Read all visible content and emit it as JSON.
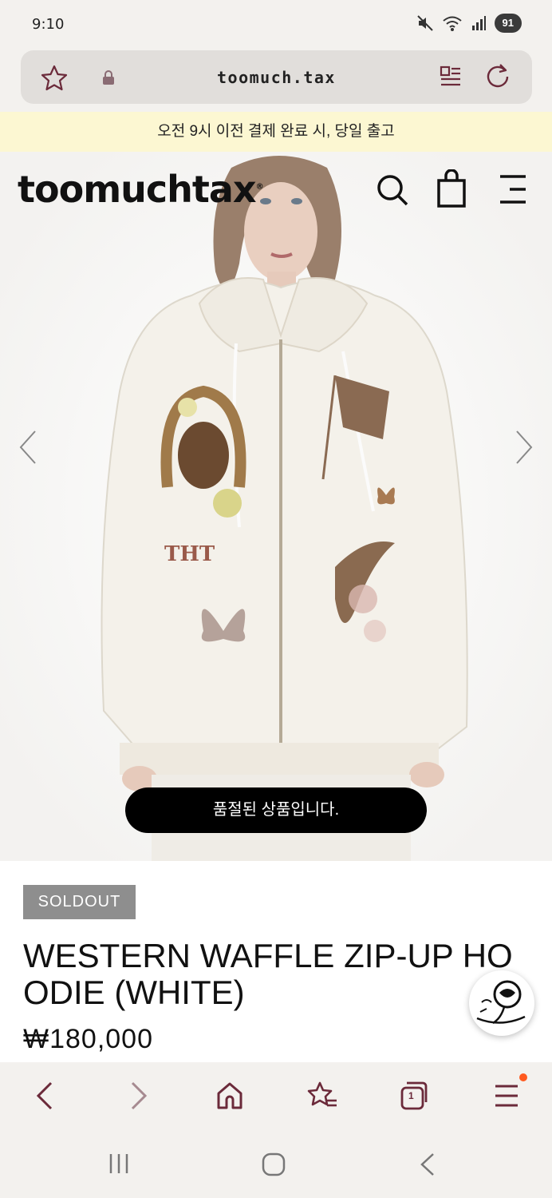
{
  "status": {
    "time": "9:10",
    "battery": "91",
    "icons": [
      "mute-icon",
      "wifi-icon",
      "signal-icon",
      "battery-icon"
    ]
  },
  "browser": {
    "url": "toomuch.tax",
    "icons": [
      "star-icon",
      "lock-icon",
      "reader-icon",
      "reload-icon"
    ]
  },
  "notice": {
    "text": "오전 9시 이전 결제 완료 시, 당일 출고"
  },
  "header": {
    "logo": "toomuchtax",
    "logo_mark": "®",
    "icons": [
      "search-icon",
      "bag-icon",
      "menu-icon"
    ]
  },
  "gallery": {
    "toast": "품절된 상품입니다.",
    "prev_icon": "chevron-left-icon",
    "next_icon": "chevron-right-icon"
  },
  "product": {
    "badge": "SOLDOUT",
    "name": "WESTERN WAFFLE ZIP-UP HOODIE (WHITE)",
    "price": "₩180,000"
  },
  "toolbar": {
    "items": [
      "back-icon",
      "forward-icon",
      "home-icon",
      "bookmarks-icon",
      "tabs-icon",
      "menu-icon"
    ],
    "tab_count": "1"
  },
  "colors": {
    "accent": "#6b2a3a",
    "notice_bg": "#fcf7d2",
    "badge_bg": "#8e8e8e",
    "toast_bg": "#000000",
    "notify_dot": "#ff5a1f"
  }
}
